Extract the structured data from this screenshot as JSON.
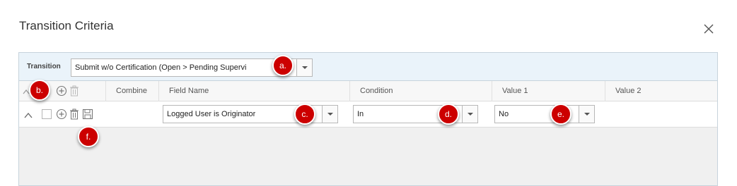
{
  "dialog": {
    "title": "Transition Criteria"
  },
  "transition": {
    "label": "Transition",
    "value": "Submit w/o Certification (Open > Pending Supervi"
  },
  "columns": {
    "combine": "Combine",
    "field_name": "Field Name",
    "condition": "Condition",
    "value1": "Value 1",
    "value2": "Value 2"
  },
  "row": {
    "field_name": "Logged User is Originator",
    "condition": "In",
    "value1": "No"
  },
  "annotations": {
    "a": "a.",
    "b": "b.",
    "c": "c.",
    "d": "d.",
    "e": "e.",
    "f": "f."
  },
  "colors": {
    "annotation_badge": "#cc0000",
    "transition_bar": "#eaf3fa",
    "grid_border": "#c7d3dc"
  },
  "icons": {
    "close": "close-icon",
    "add": "plus-circle-icon",
    "delete": "trash-icon",
    "save": "save-icon",
    "collapse": "chevron-up-icon",
    "dropdown": "caret-down-icon"
  }
}
